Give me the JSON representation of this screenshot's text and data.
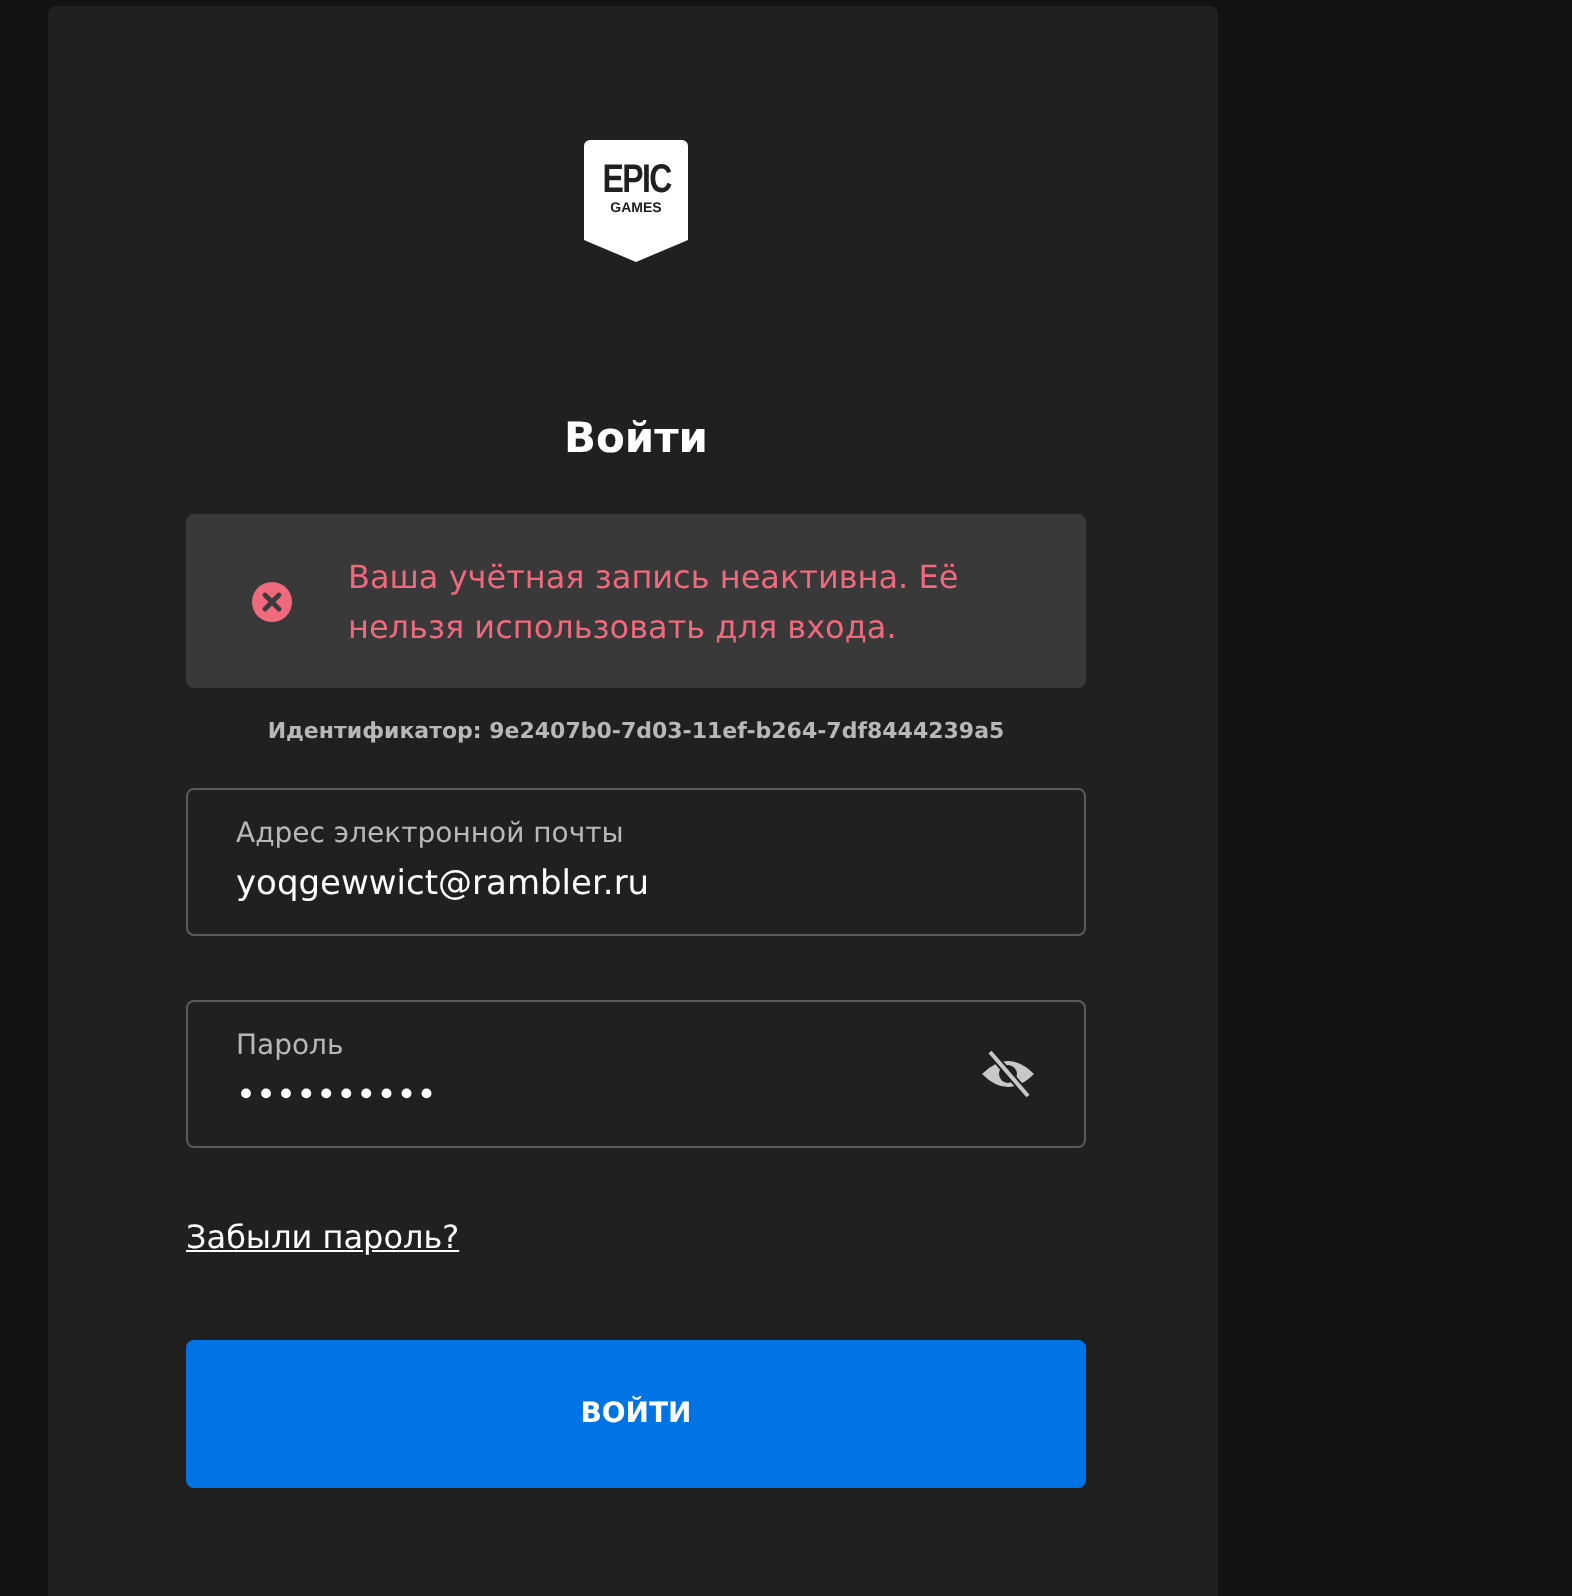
{
  "logo": {
    "line_1": "EPIC",
    "line_2": "GAMES"
  },
  "title": "Войти",
  "error": {
    "message": "Ваша учётная запись неактивна. Её нельзя использовать для входа."
  },
  "identifier": "Идентификатор: 9e2407b0-7d03-11ef-b264-7df8444239a5",
  "fields": [
    {
      "kind": "email",
      "label": "Адрес электронной почты",
      "value": "yoqgewwict@rambler.ru"
    },
    {
      "kind": "password",
      "label": "Пароль",
      "value": "••••••••••",
      "revealed": false
    }
  ],
  "forgot_link": "Забыли пароль?",
  "submit": "ВОЙТИ"
}
